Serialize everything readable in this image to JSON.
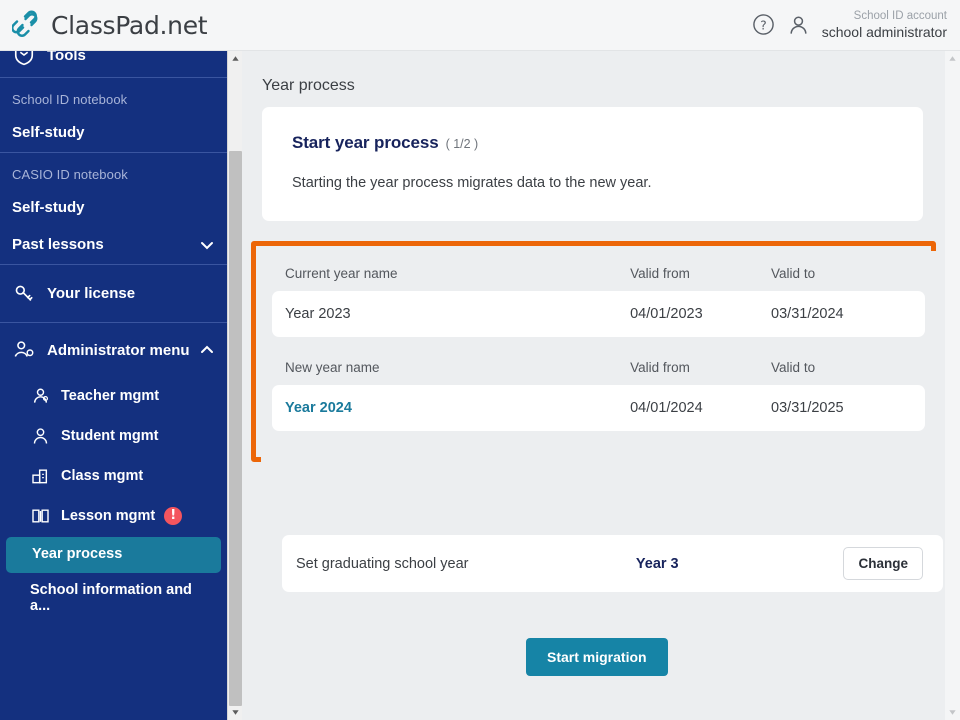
{
  "header": {
    "logo_text": "ClassPad.net",
    "logo_icon": "chain-link-icon",
    "help_icon": "help-circle-icon",
    "user_icon": "user-icon",
    "account_label": "School ID account",
    "account_name": "school administrator"
  },
  "sidebar": {
    "tools_label": "Tools",
    "sections": [
      {
        "heading": "School ID notebook",
        "items": [
          {
            "label": "Self-study"
          }
        ]
      },
      {
        "heading": "CASIO ID notebook",
        "items": [
          {
            "label": "Self-study"
          },
          {
            "label": "Past lessons",
            "chevron": "chevron-down-icon"
          }
        ]
      }
    ],
    "license_label": "Your license",
    "admin_label": "Administrator menu",
    "admin_chevron": "chevron-up-icon",
    "admin_items": [
      {
        "label": "Teacher mgmt",
        "icon": "teacher-icon"
      },
      {
        "label": "Student mgmt",
        "icon": "student-icon"
      },
      {
        "label": "Class mgmt",
        "icon": "class-icon"
      },
      {
        "label": "Lesson mgmt",
        "icon": "book-icon",
        "alert": "!"
      },
      {
        "label": "Year process",
        "icon": "",
        "active": true
      },
      {
        "label": "School information and a...",
        "icon": ""
      }
    ]
  },
  "content": {
    "page_title": "Year process",
    "intro": {
      "title": "Start year process",
      "step": "( 1/2 )",
      "description": "Starting the year process migrates data to the new year."
    },
    "year_table": {
      "current": {
        "headers": {
          "name": "Current year name",
          "valid_from": "Valid from",
          "valid_to": "Valid to"
        },
        "row": {
          "name": "Year 2023",
          "valid_from": "04/01/2023",
          "valid_to": "03/31/2024"
        }
      },
      "new": {
        "headers": {
          "name": "New year name",
          "valid_from": "Valid from",
          "valid_to": "Valid to"
        },
        "row": {
          "name": "Year 2024",
          "valid_from": "04/01/2024",
          "valid_to": "03/31/2025"
        }
      }
    },
    "graduating": {
      "label": "Set graduating school year",
      "value": "Year 3",
      "change_label": "Change"
    },
    "start_button": "Start migration"
  },
  "colors": {
    "sidebar_blue": "#14307f",
    "accent_teal": "#1a7a9c",
    "highlight_orange": "#ec6608",
    "alert_red": "#f4555e",
    "title_navy": "#17235c"
  }
}
